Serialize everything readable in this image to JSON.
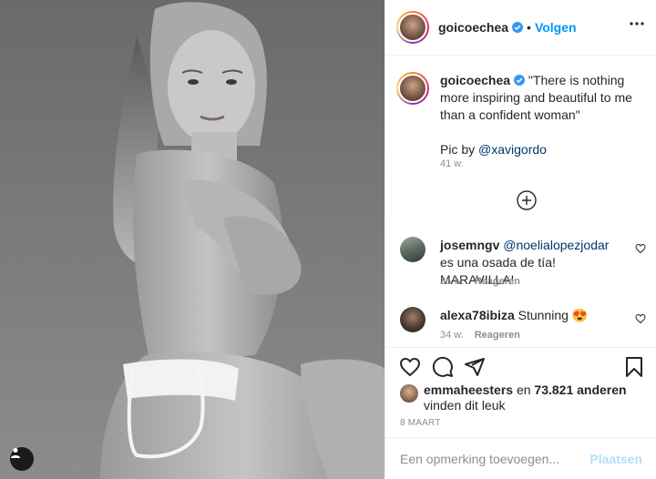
{
  "post": {
    "username": "goicoechea",
    "verified_icon": "verified-badge-icon",
    "dot": "•",
    "follow_label": "Volgen",
    "more_icon": "more-options-icon",
    "tag_icon": "user-tag-icon"
  },
  "caption": {
    "username": "goicoechea",
    "text": "\"There is nothing more inspiring and beautiful to me than a confident woman\"",
    "pic_by_prefix": "Pic by ",
    "pic_by_mention": "@xavigordo",
    "time": "41 w.",
    "load_more_icon": "add-circle-icon"
  },
  "comments": [
    {
      "username": "josemngv",
      "mention": "@noelialopezjodar",
      "text": " es una osada de tía! MARAVILLA!",
      "time": "35 w.",
      "reply_label": "Reageren",
      "like_icon": "heart-outline-icon"
    },
    {
      "username": "alexa78ibiza",
      "mention": "",
      "text": " Stunning 😍",
      "time": "34 w.",
      "reply_label": "Reageren",
      "like_icon": "heart-outline-icon"
    }
  ],
  "actions": {
    "like_icon": "heart-icon",
    "comment_icon": "comment-icon",
    "share_icon": "share-icon",
    "save_icon": "bookmark-icon"
  },
  "likes": {
    "user": "emmaheesters",
    "connector": " en ",
    "count": "73.821 anderen",
    "suffix": " vinden dit leuk"
  },
  "date": "8 MAART",
  "comment_box": {
    "placeholder": "Een opmerking toevoegen...",
    "post_label": "Plaatsen"
  },
  "colors": {
    "accent": "#0095f6",
    "mention": "#00376b",
    "muted": "#8e8e8e",
    "post_disabled": "#b2dffc"
  }
}
